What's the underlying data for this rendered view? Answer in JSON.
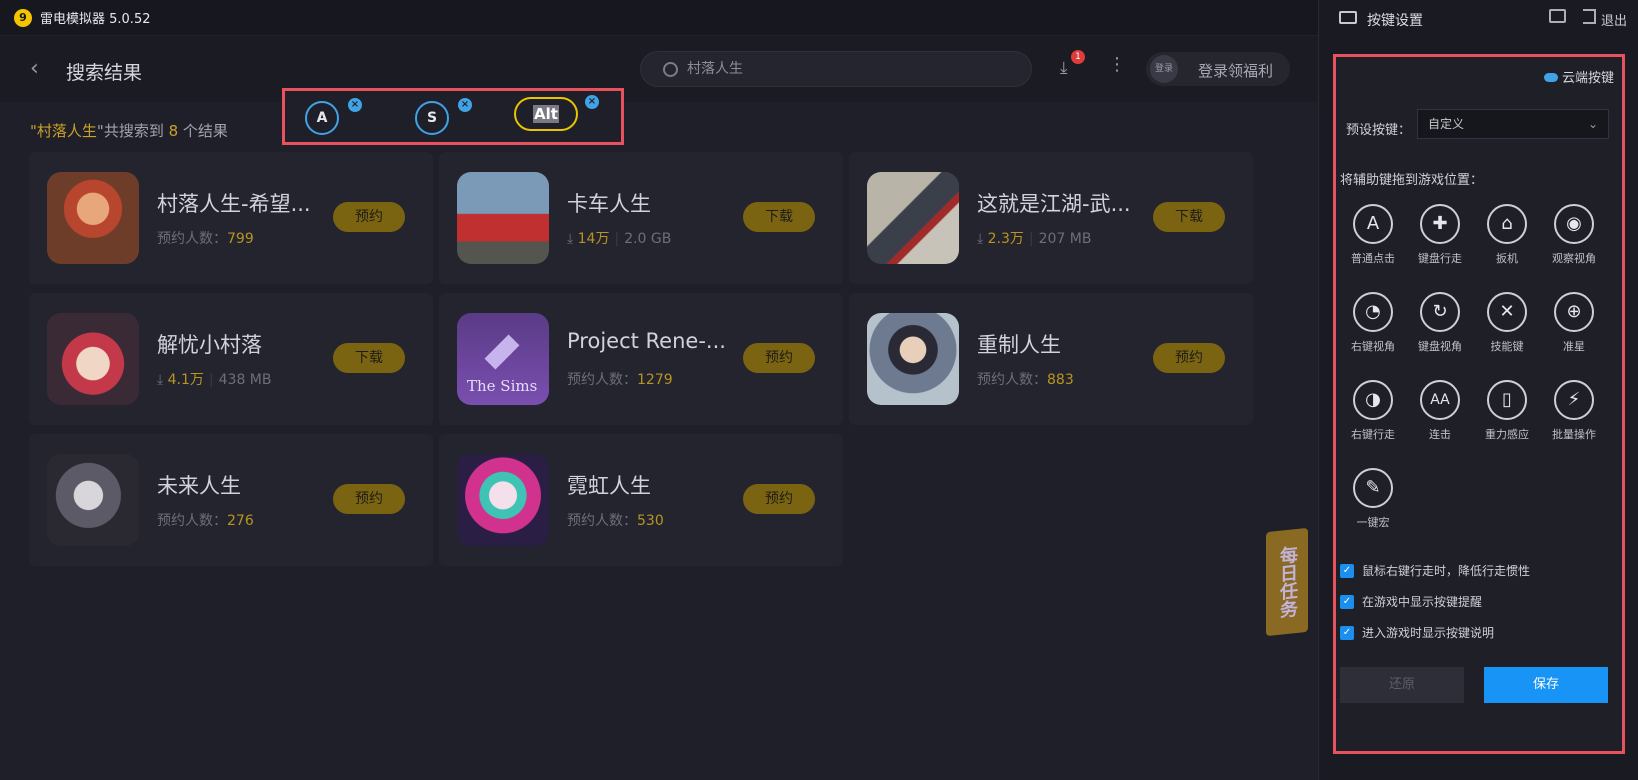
{
  "app": {
    "title": "雷电模拟器 5.0.52",
    "logo_glyph": "9"
  },
  "header": {
    "back_glyph": "‹",
    "title": "搜索结果",
    "search_value": "村落人生",
    "download_glyph": "⤓",
    "download_badge": "1",
    "more_glyph": "⋮",
    "avatar_text": "登录",
    "login_text": "登录领福利"
  },
  "summary": {
    "prefix": "\"",
    "query": "村落人生",
    "middle": "\"共搜索到 ",
    "count": "8",
    "suffix": " 个结果"
  },
  "results": [
    {
      "title": "村落人生-希望...",
      "meta_label": "预约人数：",
      "meta_value": "799",
      "meta_size": "",
      "button": "预约",
      "dl_glyph": ""
    },
    {
      "title": "卡车人生",
      "meta_label": "",
      "meta_value": "14万",
      "meta_size": "2.0 GB",
      "button": "下载",
      "dl_glyph": "⤓ "
    },
    {
      "title": "这就是江湖-武...",
      "meta_label": "",
      "meta_value": "2.3万",
      "meta_size": "207 MB",
      "button": "下载",
      "dl_glyph": "⤓ "
    },
    {
      "title": "解忧小村落",
      "meta_label": "",
      "meta_value": "4.1万",
      "meta_size": "438 MB",
      "button": "下载",
      "dl_glyph": "⤓ "
    },
    {
      "title": "Project Rene-...",
      "meta_label": "预约人数：",
      "meta_value": "1279",
      "meta_size": "",
      "button": "预约",
      "dl_glyph": ""
    },
    {
      "title": "重制人生",
      "meta_label": "预约人数：",
      "meta_value": "883",
      "meta_size": "",
      "button": "预约",
      "dl_glyph": ""
    },
    {
      "title": "未来人生",
      "meta_label": "预约人数：",
      "meta_value": "276",
      "meta_size": "",
      "button": "预约",
      "dl_glyph": ""
    },
    {
      "title": "霓虹人生",
      "meta_label": "预约人数：",
      "meta_value": "530",
      "meta_size": "",
      "button": "预约",
      "dl_glyph": ""
    }
  ],
  "thumb_text": {
    "sims": "The Sims"
  },
  "daily_task": "每日任务",
  "key_overlay": {
    "keys": [
      {
        "label": "A"
      },
      {
        "label": "S"
      }
    ],
    "alt_label": "Alt",
    "close_glyph": "×"
  },
  "panel": {
    "title": "按键设置",
    "exit_label": "退出",
    "cloud_label": "云端按键",
    "preset_label": "预设按键：",
    "preset_value": "自定义",
    "preset_chevron": "⌄",
    "drag_hint": "将辅助键拖到游戏位置：",
    "tools": [
      {
        "label": "普通点击",
        "glyph": "A"
      },
      {
        "label": "键盘行走",
        "glyph": "✚"
      },
      {
        "label": "扳机",
        "glyph": "⌂"
      },
      {
        "label": "观察视角",
        "glyph": "◉"
      },
      {
        "label": "右键视角",
        "glyph": "◔"
      },
      {
        "label": "键盘视角",
        "glyph": "↻"
      },
      {
        "label": "技能键",
        "glyph": "✕"
      },
      {
        "label": "准星",
        "glyph": "⊕"
      },
      {
        "label": "右键行走",
        "glyph": "◑"
      },
      {
        "label": "连击",
        "glyph": "AA"
      },
      {
        "label": "重力感应",
        "glyph": "▯"
      },
      {
        "label": "批量操作",
        "glyph": "⚡"
      },
      {
        "label": "一键宏",
        "glyph": "✎"
      }
    ],
    "checks": [
      {
        "label": "鼠标右键行走时，降低行走惯性"
      },
      {
        "label": "在游戏中显示按键提醒"
      },
      {
        "label": "进入游戏时显示按键说明"
      }
    ],
    "check_glyph": "✓",
    "restore_label": "还原",
    "save_label": "保存"
  }
}
